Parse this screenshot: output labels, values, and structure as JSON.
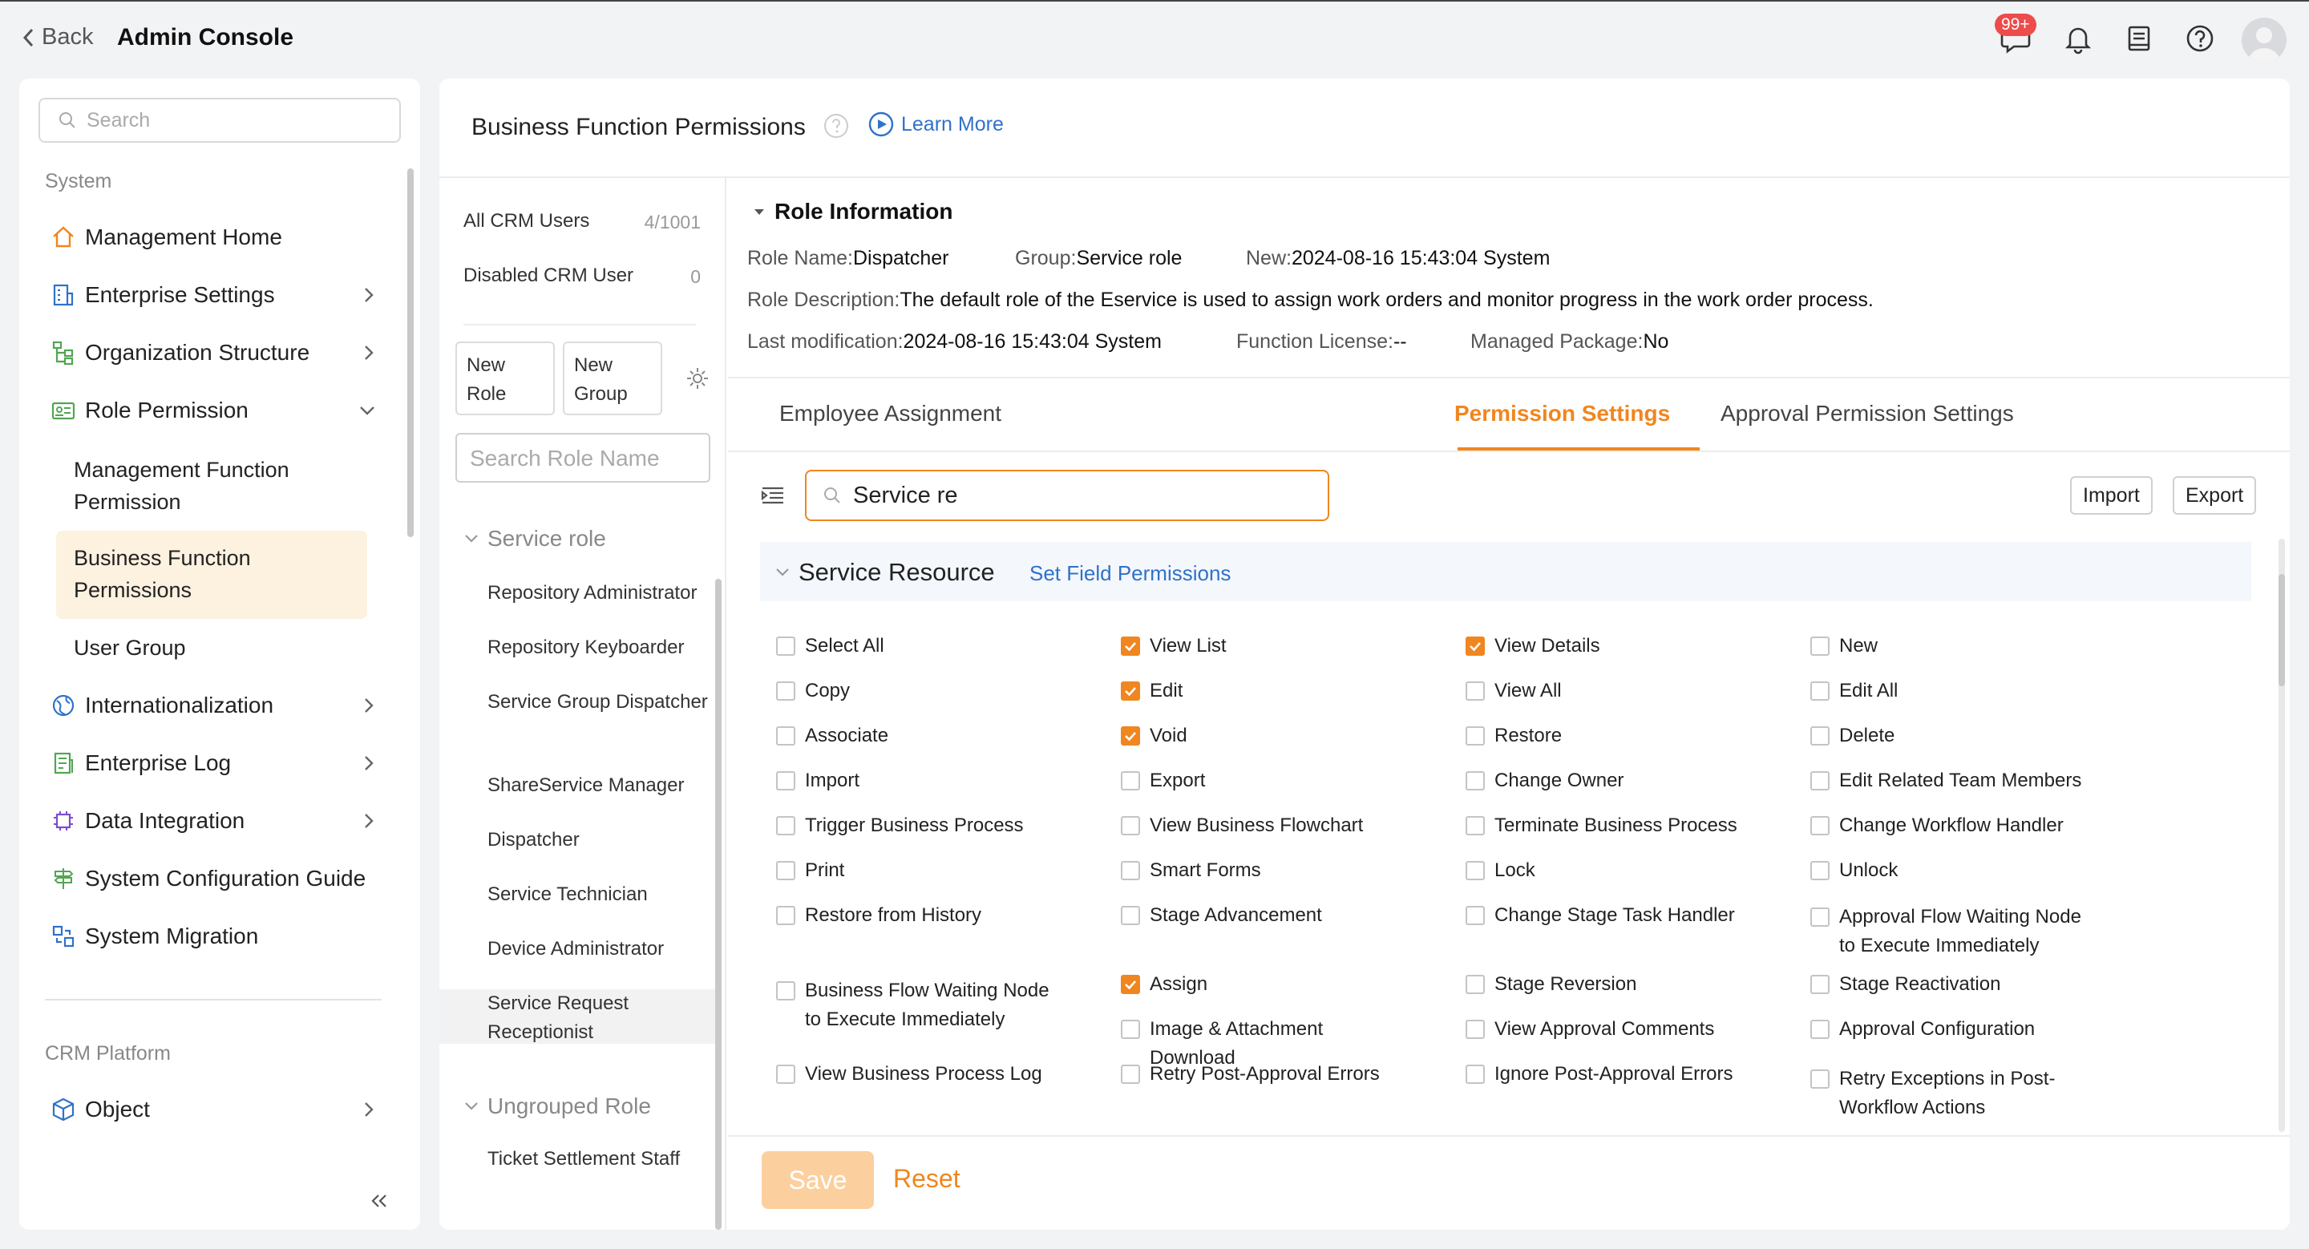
{
  "topbar": {
    "back_label": "Back",
    "title": "Admin Console",
    "notif_badge": "99+"
  },
  "sidebar": {
    "search_placeholder": "Search",
    "section_system": "System",
    "items": [
      {
        "label": "Management Home",
        "icon": "home-icon"
      },
      {
        "label": "Enterprise Settings",
        "icon": "building-icon"
      },
      {
        "label": "Organization Structure",
        "icon": "org-tree-icon"
      },
      {
        "label": "Role Permission",
        "icon": "id-card-icon"
      },
      {
        "label": "Internationalization",
        "icon": "globe-icon"
      },
      {
        "label": "Enterprise Log",
        "icon": "log-icon"
      },
      {
        "label": "Data Integration",
        "icon": "chip-icon"
      },
      {
        "label": "System Configuration Guide",
        "icon": "signpost-icon"
      },
      {
        "label": "System Migration",
        "icon": "migration-icon"
      }
    ],
    "subitems": [
      "Management Function Permission",
      "Business Function Permissions",
      "User Group"
    ],
    "section_crm": "CRM Platform",
    "crm_items": [
      {
        "label": "Object",
        "icon": "cube-icon"
      }
    ]
  },
  "header": {
    "title": "Business Function Permissions",
    "learn_more": "Learn More"
  },
  "roles": {
    "all_users_label": "All CRM Users",
    "all_users_count": "4/1001",
    "disabled_label": "Disabled CRM User",
    "disabled_count": "0",
    "new_role": "New Role",
    "new_group": "New Group",
    "search_placeholder": "Search Role Name",
    "group_service": "Service role",
    "service_roles": [
      "Repository Administrator",
      "Repository Keyboarder",
      "Service Group Dispatcher",
      "ShareService Manager",
      "Dispatcher",
      "Service Technician",
      "Device Administrator",
      "Service Request Receptionist"
    ],
    "group_ungrouped": "Ungrouped Role",
    "ungrouped_roles": [
      "Ticket Settlement Staff"
    ]
  },
  "role_info": {
    "heading": "Role Information",
    "role_name_label": "Role Name:",
    "role_name": "Dispatcher",
    "group_label": "Group:",
    "group": "Service role",
    "new_label": "New:",
    "new": "2024-08-16 15:43:04 System",
    "desc_label": "Role Description:",
    "desc": "The default role of the Eservice is used to assign work orders and monitor progress in the work order process.",
    "lastmod_label": "Last modification:",
    "lastmod": "2024-08-16 15:43:04 System",
    "license_label": "Function License:",
    "license": "--",
    "managed_label": "Managed Package:",
    "managed": "No"
  },
  "tabs": [
    "Employee Assignment",
    "Permission Settings",
    "Approval Permission Settings"
  ],
  "perm_search_value": "Service re",
  "import_label": "Import",
  "export_label": "Export",
  "section": {
    "title": "Service Resource",
    "link": "Set Field Permissions"
  },
  "permissions": [
    [
      {
        "label": "Select All",
        "checked": false
      },
      {
        "label": "View List",
        "checked": true
      },
      {
        "label": "View Details",
        "checked": true
      },
      {
        "label": "New",
        "checked": false
      }
    ],
    [
      {
        "label": "Copy",
        "checked": false
      },
      {
        "label": "Edit",
        "checked": true
      },
      {
        "label": "View All",
        "checked": false
      },
      {
        "label": "Edit All",
        "checked": false
      }
    ],
    [
      {
        "label": "Associate",
        "checked": false
      },
      {
        "label": "Void",
        "checked": true
      },
      {
        "label": "Restore",
        "checked": false
      },
      {
        "label": "Delete",
        "checked": false
      }
    ],
    [
      {
        "label": "Import",
        "checked": false
      },
      {
        "label": "Export",
        "checked": false
      },
      {
        "label": "Change Owner",
        "checked": false
      },
      {
        "label": "Edit Related Team Members",
        "checked": false
      }
    ],
    [
      {
        "label": "Trigger Business Process",
        "checked": false
      },
      {
        "label": "View Business Flowchart",
        "checked": false
      },
      {
        "label": "Terminate Business Process",
        "checked": false
      },
      {
        "label": "Change Workflow Handler",
        "checked": false
      }
    ],
    [
      {
        "label": "Print",
        "checked": false
      },
      {
        "label": "Smart Forms",
        "checked": false
      },
      {
        "label": "Lock",
        "checked": false
      },
      {
        "label": "Unlock",
        "checked": false
      }
    ],
    [
      {
        "label": "Restore from History",
        "checked": false
      },
      {
        "label": "Stage Advancement",
        "checked": false
      },
      {
        "label": "Change Stage Task Handler",
        "checked": false
      },
      {
        "label": "Approval Flow Waiting Node to Execute Immediately",
        "checked": false
      }
    ],
    [
      {
        "label": "Business Flow Waiting Node to Execute Immediately",
        "checked": false
      },
      {
        "label": "Assign",
        "checked": true
      },
      {
        "label": "Stage Reversion",
        "checked": false
      },
      {
        "label": "Stage Reactivation",
        "checked": false
      }
    ],
    [
      {
        "label": "",
        "checked": false
      },
      {
        "label": "Image & Attachment Download",
        "checked": false
      },
      {
        "label": "View Approval Comments",
        "checked": false
      },
      {
        "label": "Approval Configuration",
        "checked": false
      }
    ],
    [
      {
        "label": "View Business Process Log",
        "checked": false
      },
      {
        "label": "Retry Post-Approval Errors",
        "checked": false
      },
      {
        "label": "Ignore Post-Approval Errors",
        "checked": false
      },
      {
        "label": "Retry Exceptions in Post-Workflow Actions",
        "checked": false
      }
    ]
  ],
  "footer": {
    "save": "Save",
    "reset": "Reset"
  },
  "colors": {
    "accent": "#f0861f",
    "link": "#2f72c8",
    "badge": "#ee4b4b"
  }
}
